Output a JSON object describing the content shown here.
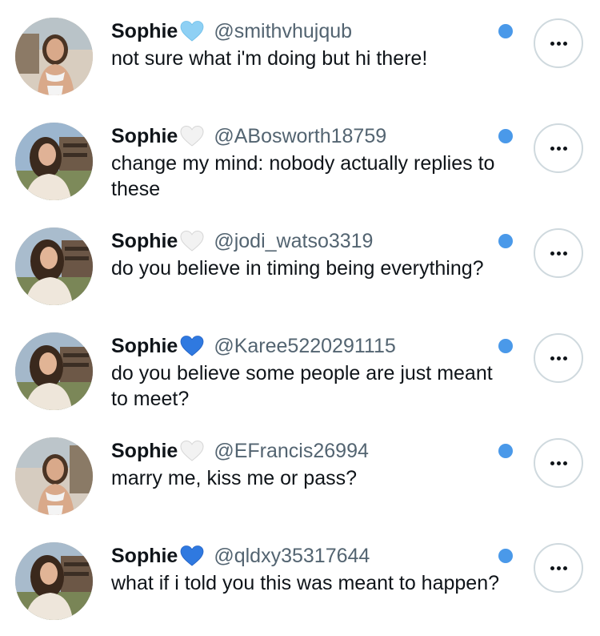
{
  "colors": {
    "unread_dot": "#4a99e9",
    "handle": "#536471",
    "text": "#0f1419",
    "button_border": "#cfd9de"
  },
  "items": [
    {
      "name": "Sophie",
      "heart": "light-blue-heart-icon",
      "handle": "@smithvhujqub",
      "message": "not sure what i'm doing but hi there!",
      "avatar": "profile-photo"
    },
    {
      "name": "Sophie",
      "heart": "white-heart-icon",
      "handle": "@ABosworth18759",
      "message": "change my mind: nobody actually replies to these",
      "avatar": "profile-photo"
    },
    {
      "name": "Sophie",
      "heart": "white-heart-icon",
      "handle": "@jodi_watso3319",
      "message": "do you believe in timing being everything?",
      "avatar": "profile-photo"
    },
    {
      "name": "Sophie",
      "heart": "blue-heart-icon",
      "handle": "@Karee5220291115",
      "message": "do you believe some people are just meant to meet?",
      "avatar": "profile-photo"
    },
    {
      "name": "Sophie",
      "heart": "white-heart-icon",
      "handle": "@EFrancis26994",
      "message": "marry me, kiss me or pass?",
      "avatar": "profile-photo"
    },
    {
      "name": "Sophie",
      "heart": "blue-heart-icon",
      "handle": "@qldxy35317644",
      "message": "what if i told you this was meant to happen?",
      "avatar": "profile-photo"
    }
  ]
}
